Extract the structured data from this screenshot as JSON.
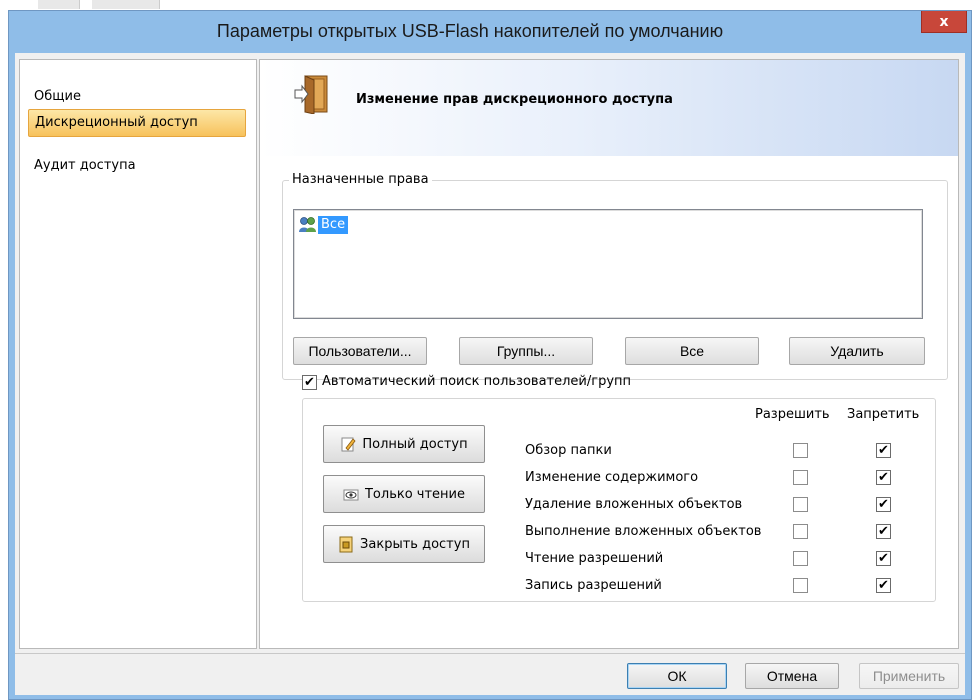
{
  "window": {
    "title": "Параметры открытых USB-Flash накопителей по умолчанию",
    "close_label": "x"
  },
  "nav": {
    "items": [
      {
        "label": "Общие",
        "selected": false
      },
      {
        "label": "Дискреционный доступ",
        "selected": true
      },
      {
        "label": "Аудит доступа",
        "selected": false
      }
    ]
  },
  "header": {
    "title": "Изменение прав дискреционного доступа",
    "icon": "door-icon"
  },
  "rights": {
    "legend": "Назначенные права",
    "entries": [
      {
        "label": "Все",
        "icon": "group-icon",
        "selected": true
      }
    ]
  },
  "buttons": {
    "users": "Пользователи...",
    "groups": "Группы...",
    "all": "Все",
    "delete": "Удалить"
  },
  "auto_search": {
    "label": "Автоматический поиск пользователей/групп",
    "checked": true
  },
  "permissions": {
    "allow_header": "Разрешить",
    "deny_header": "Запретить",
    "presets": [
      {
        "label": "Полный доступ",
        "icon": "pencil-icon"
      },
      {
        "label": "Только чтение",
        "icon": "eye-icon"
      },
      {
        "label": "Закрыть доступ",
        "icon": "lock-icon"
      }
    ],
    "rows": [
      {
        "label": "Обзор папки",
        "allow": false,
        "deny": true
      },
      {
        "label": "Изменение содержимого",
        "allow": false,
        "deny": true
      },
      {
        "label": "Удаление вложенных объектов",
        "allow": false,
        "deny": true
      },
      {
        "label": "Выполнение вложенных объектов",
        "allow": false,
        "deny": true
      },
      {
        "label": "Чтение разрешений",
        "allow": false,
        "deny": true
      },
      {
        "label": "Запись разрешений",
        "allow": false,
        "deny": true
      }
    ]
  },
  "footer": {
    "ok": "ОК",
    "cancel": "Отмена",
    "apply": "Применить"
  },
  "colors": {
    "title_bar": "#8fbde8",
    "close_button": "#c8473a",
    "nav_selected": "#f7c25c",
    "list_selection": "#3399ff"
  }
}
